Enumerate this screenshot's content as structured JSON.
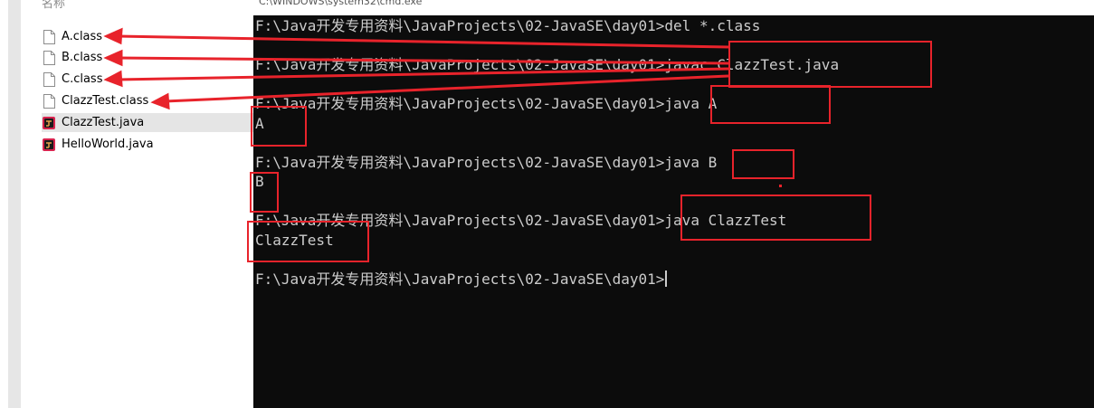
{
  "explorer": {
    "column_header": "名称",
    "files": [
      {
        "name": "A.class",
        "icon": "blank-file-icon"
      },
      {
        "name": "B.class",
        "icon": "blank-file-icon"
      },
      {
        "name": "C.class",
        "icon": "blank-file-icon"
      },
      {
        "name": "ClazzTest.class",
        "icon": "blank-file-icon"
      },
      {
        "name": "ClazzTest.java",
        "icon": "java-file-icon"
      },
      {
        "name": "HelloWorld.java",
        "icon": "java-file-icon"
      }
    ],
    "selected_index": 4
  },
  "console": {
    "title": "C:\\WINDOWS\\system32\\cmd.exe",
    "lines": [
      "F:\\Java开发专用资料\\JavaProjects\\02-JavaSE\\day01>del *.class",
      "",
      "F:\\Java开发专用资料\\JavaProjects\\02-JavaSE\\day01>javac ClazzTest.java",
      "",
      "F:\\Java开发专用资料\\JavaProjects\\02-JavaSE\\day01>java A",
      "A",
      "",
      "F:\\Java开发专用资料\\JavaProjects\\02-JavaSE\\day01>java B",
      "B",
      "",
      "F:\\Java开发专用资料\\JavaProjects\\02-JavaSE\\day01>java ClazzTest",
      "ClazzTest",
      "",
      "F:\\Java开发专用资料\\JavaProjects\\02-JavaSE\\day01>"
    ]
  },
  "colors": {
    "annotation": "#e8232b",
    "console_bg": "#0c0c0c",
    "console_text": "#cccccc",
    "selected_row": "#e5e5e5"
  }
}
